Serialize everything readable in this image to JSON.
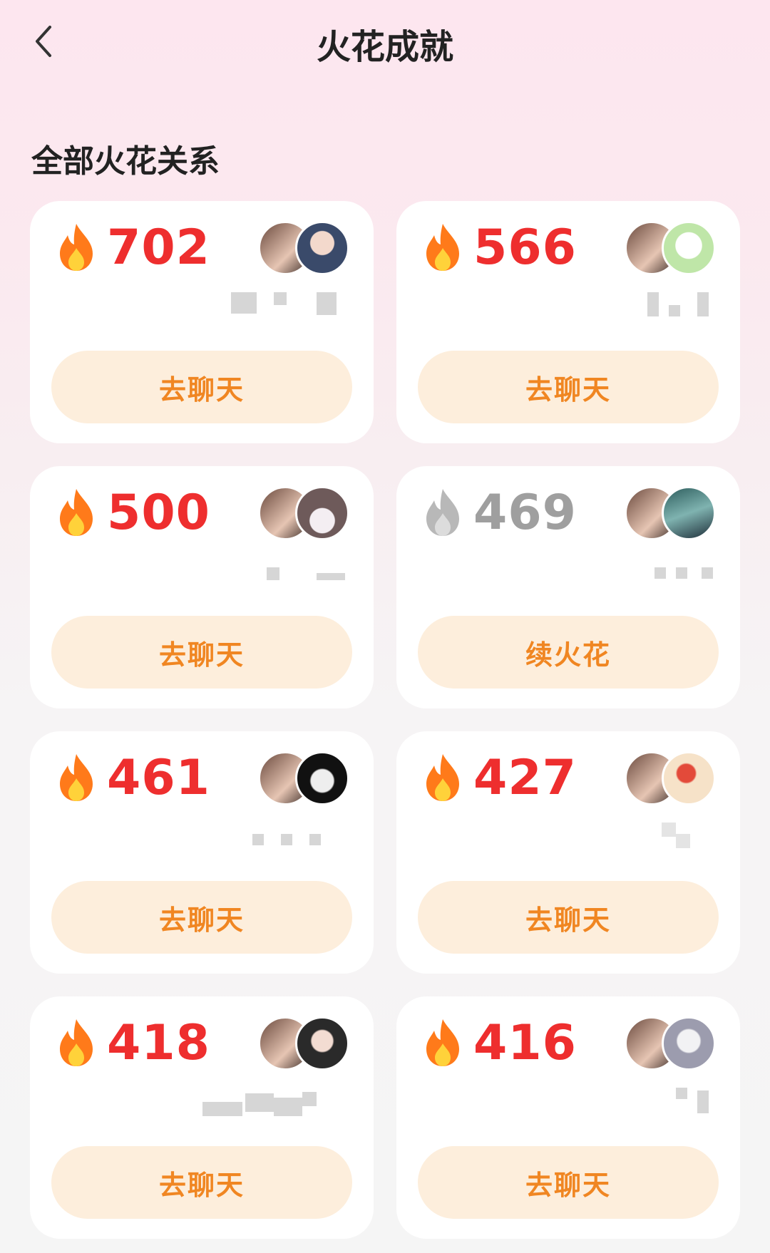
{
  "header": {
    "title": "火花成就",
    "back_icon": "chevron-left-icon"
  },
  "section": {
    "title": "全部火花关系"
  },
  "cards": [
    {
      "count": "702",
      "active": true,
      "button": "去聊天",
      "avatar2_color": "#3a4a6a"
    },
    {
      "count": "566",
      "active": true,
      "button": "去聊天",
      "avatar2_color": "#bfe6a8"
    },
    {
      "count": "500",
      "active": true,
      "button": "去聊天",
      "avatar2_color": "#8a7a7a"
    },
    {
      "count": "469",
      "active": false,
      "button": "续火花",
      "avatar2_color": "#3e6c6a"
    },
    {
      "count": "461",
      "active": true,
      "button": "去聊天",
      "avatar2_color": "#1c1c1c"
    },
    {
      "count": "427",
      "active": true,
      "button": "去聊天",
      "avatar2_color": "#f0c8a0"
    },
    {
      "count": "418",
      "active": true,
      "button": "去聊天",
      "avatar2_color": "#2a2a2a"
    },
    {
      "count": "416",
      "active": true,
      "button": "去聊天",
      "avatar2_color": "#c8c8d4"
    }
  ],
  "colors": {
    "count_active": "#ee2e2e",
    "count_inactive": "#9f9f9f",
    "button_bg": "#fdeedc",
    "button_text": "#f08622"
  }
}
